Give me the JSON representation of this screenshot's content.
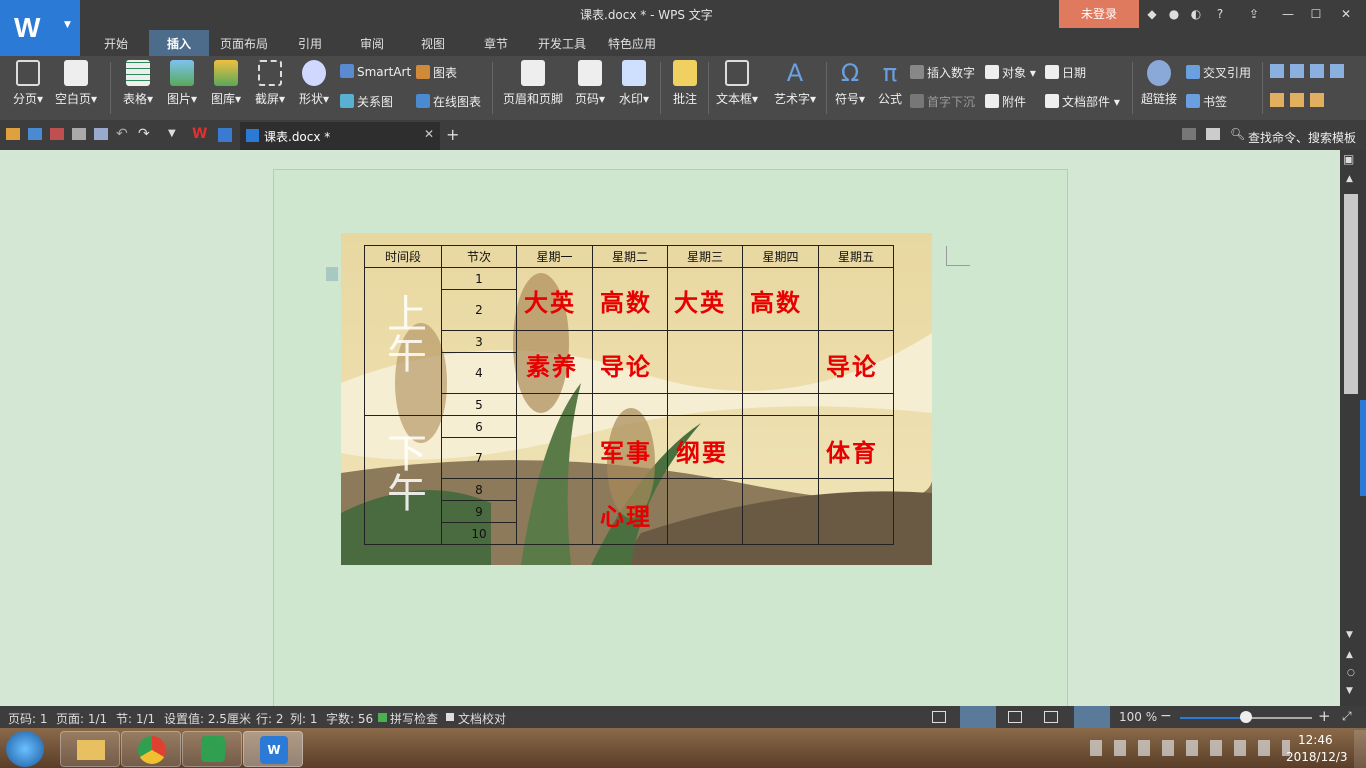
{
  "titlebar": {
    "title": "课表.docx * - WPS 文字",
    "login": "未登录"
  },
  "tabs": [
    "开始",
    "插入",
    "页面布局",
    "引用",
    "审阅",
    "视图",
    "章节",
    "开发工具",
    "特色应用"
  ],
  "active_tab": "插入",
  "ribbon": {
    "page_break": "分页",
    "blank_page": "空白页",
    "table": "表格",
    "picture": "图片",
    "gallery": "图库",
    "screenshot": "截屏",
    "shape": "形状",
    "smartart": "SmartArt",
    "chart": "图表",
    "relation": "关系图",
    "online_chart": "在线图表",
    "header_footer": "页眉和页脚",
    "page_number": "页码",
    "watermark": "水印",
    "comment": "批注",
    "textbox": "文本框",
    "wordart": "艺术字",
    "symbol": "符号",
    "formula": "公式",
    "insert_number": "插入数字",
    "dropcap": "首字下沉",
    "object": "对象",
    "attachment": "附件",
    "date": "日期",
    "doc_parts": "文档部件",
    "hyperlink": "超链接",
    "cross_ref": "交叉引用",
    "bookmark": "书签"
  },
  "quickbar": {
    "doc_tab": "课表.docx *",
    "search": "查找命令、搜索模板"
  },
  "schedule": {
    "headers": [
      "时间段",
      "节次",
      "星期一",
      "星期二",
      "星期三",
      "星期四",
      "星期五"
    ],
    "morning": "上午",
    "afternoon": "下午",
    "periods": [
      "1",
      "2",
      "3",
      "4",
      "5",
      "6",
      "7",
      "8",
      "9",
      "10"
    ],
    "cells": {
      "r1_mon": "大英",
      "r1_tue": "高数",
      "r1_wed": "大英",
      "r1_thu": "高数",
      "r2_mon": "素养",
      "r2_tue": "导论",
      "r2_fri": "导论",
      "r3_tue": "军事",
      "r3_wed": "纲要",
      "r3_fri": "体育",
      "r4_tue": "心理"
    }
  },
  "status": {
    "page": "页码: 1",
    "pages": "页面: 1/1",
    "section": "节: 1/1",
    "setting": "设置值: 2.5厘米",
    "row": "行: 2",
    "col": "列: 1",
    "words": "字数: 56",
    "spell": "拼写检查",
    "proof": "文档校对",
    "zoom": "100 %"
  },
  "tray": {
    "time": "12:46",
    "date": "2018/12/3"
  },
  "colors": {
    "accent": "#2b7bd6",
    "login": "#e07a5f",
    "red_text": "#e80000"
  }
}
